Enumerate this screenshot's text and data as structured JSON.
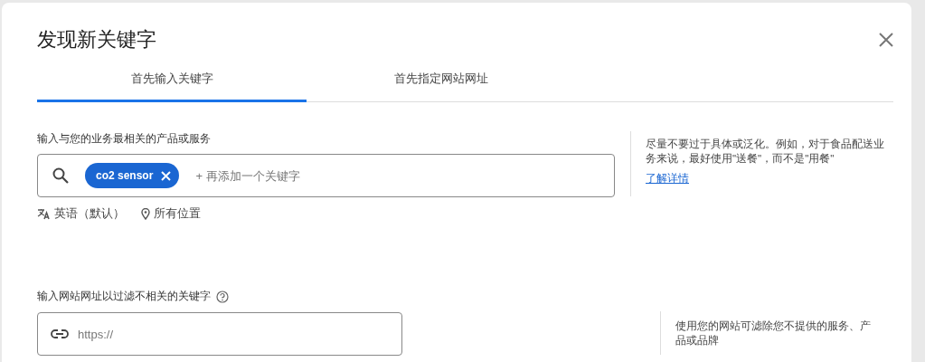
{
  "dialog": {
    "title": "发现新关键字"
  },
  "tabs": [
    {
      "label": "首先输入关键字",
      "selected": true
    },
    {
      "label": "首先指定网站网址",
      "selected": false
    }
  ],
  "keyword_section": {
    "label": "输入与您的业务最相关的产品或服务",
    "chips": [
      {
        "label": "co2 sensor"
      }
    ],
    "placeholder": "+ 再添加一个关键字",
    "language": "英语（默认）",
    "location": "所有位置",
    "hint": "尽量不要过于具体或泛化。例如，对于食品配送业务来说，最好使用\"送餐\"，而不是\"用餐\"",
    "learn_more": "了解详情"
  },
  "website_section": {
    "label": "输入网站网址以过滤不相关的关键字",
    "placeholder": "https://",
    "hint": "使用您的网站可滤除您不提供的服务、产品或品牌"
  }
}
